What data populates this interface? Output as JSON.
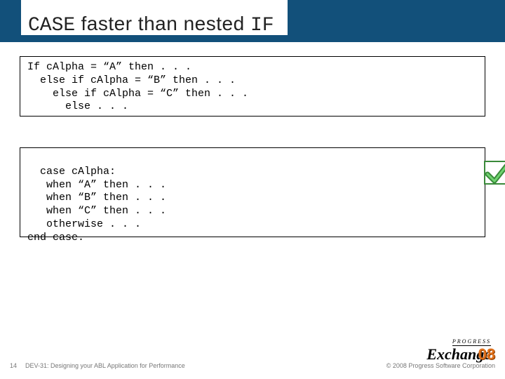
{
  "header": {
    "title_prefix": "CASE",
    "title_mid": " faster than nested ",
    "title_suffix": "IF"
  },
  "code": {
    "box1": "If cAlpha = “A” then . . .\n  else if cAlpha = “B” then . . .\n    else if cAlpha = “C” then . . .\n      else . . .",
    "box2": "case cAlpha:\n   when “A” then . . .\n   when “B” then . . .\n   when “C” then . . .\n   otherwise . . .\nend case."
  },
  "icons": {
    "check": "checkmark-icon"
  },
  "footer": {
    "page": "14",
    "session": "DEV-31: Designing your ABL Application for Performance",
    "copyright": "© 2008 Progress Software Corporation"
  },
  "logo": {
    "top": "PROGRESS",
    "main": "Exchange",
    "year": "08"
  }
}
